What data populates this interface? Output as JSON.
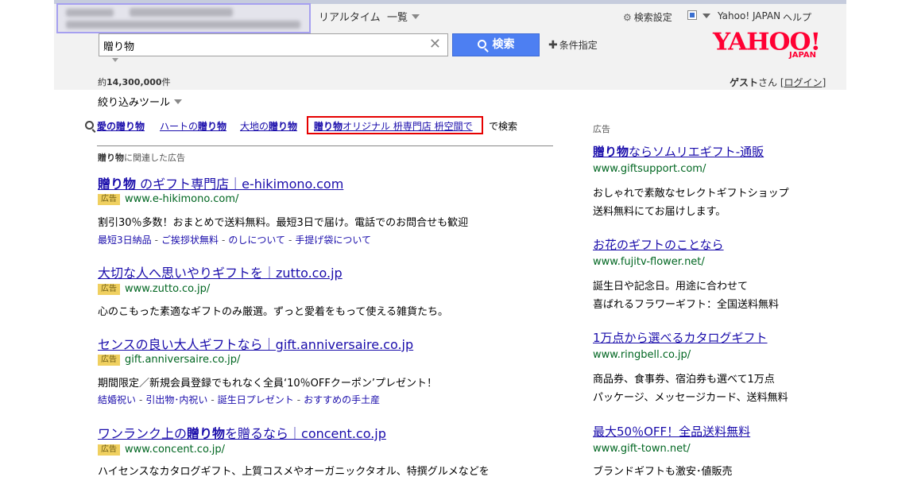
{
  "header": {
    "nav_realtime": "リアルタイム",
    "nav_list": "一覧",
    "settings": "検索設定",
    "yahoo_japan": "Yahoo! JAPAN",
    "help": "ヘルプ",
    "logo_main": "YAHOO!",
    "logo_sub": "JAPAN"
  },
  "search": {
    "query": "贈り物",
    "button": "検索",
    "advanced": "条件指定"
  },
  "results": {
    "count_prefix": "約",
    "count": "14,300,000",
    "count_suffix": "件"
  },
  "user": {
    "name": "ゲスト",
    "honorific": "さん",
    "bracket_open": "[",
    "login": "ログイン",
    "bracket_close": "]"
  },
  "filter": {
    "label": "絞り込みツール"
  },
  "related": {
    "items": [
      {
        "bold": "愛の贈り物",
        "rest": ""
      },
      {
        "bold": "",
        "pre": "ハートの",
        "bold2": "贈り物"
      },
      {
        "bold": "",
        "pre": "大地の",
        "bold2": "贈り物"
      },
      {
        "bold": "贈り物",
        "rest": "オリジナル 枡専門店 枡空間で"
      }
    ],
    "suffix": "で検索"
  },
  "ad_heading": {
    "bold": "贈り物",
    "rest": "に関連した広告"
  },
  "badge_label": "広告",
  "main_ads": [
    {
      "title_bold": "贈り物",
      "title_rest": " のギフト専門店｜e-hikimono.com",
      "url": "www.e-hikimono.com/",
      "desc": "割引30％多数！おまとめで送料無料。最短3日で届け。電話でのお問合せも歓迎",
      "sitelinks": [
        "最短3日納品",
        "ご挨拶状無料",
        "のしについて",
        "手提げ袋について"
      ]
    },
    {
      "title_pre": "大切な人へ思いやりギフトを｜zutto.co.jp",
      "url": "www.zutto.co.jp/",
      "desc": "心のこもった素適なギフトのみ厳選。ずっと愛着をもって使える雑貨たち。"
    },
    {
      "title_pre": "センスの良い大人ギフトなら｜gift.anniversaire.co.jp",
      "url": "gift.anniversaire.co.jp/",
      "desc": "期間限定／新規会員登録でもれなく全員‘10％OFFクーポン’プレゼント！",
      "sitelinks": [
        "結婚祝い",
        "引出物･内祝い",
        "誕生日プレゼント",
        "おすすめの手土産"
      ]
    },
    {
      "title_pre": "ワンランク上の",
      "title_bold": "贈り物",
      "title_rest": "を贈るなら｜concent.co.jp",
      "url": "www.concent.co.jp/",
      "desc": "ハイセンスなカタログギフト、上質コスメやオーガニックタオル、特撰グルメなどを"
    }
  ],
  "side_heading": "広告",
  "side_ads": [
    {
      "title_bold": "贈り物",
      "title_rest": "ならソムリエギフト-通販",
      "url": "www.giftsupport.com/",
      "desc1": "おしゃれで素敵なセレクトギフトショップ",
      "desc2": "送料無料にてお届けします。"
    },
    {
      "title_rest": "お花のギフトのことなら",
      "url": "www.fujitv-flower.net/",
      "desc1": "誕生日や記念日。用途に合わせて",
      "desc2": "喜ばれるフラワーギフト：全国送料無料"
    },
    {
      "title_rest": "1万点から選べるカタログギフト",
      "url": "www.ringbell.co.jp/",
      "desc1": "商品券、食事券、宿泊券も選べて1万点",
      "desc2": "パッケージ、メッセージカード、送料無料"
    },
    {
      "title_rest": "最大50％OFF！全品送料無料",
      "url": "www.gift-town.net/",
      "desc1": "ブランドギフトも激安･値販売"
    }
  ],
  "colors": {
    "link": "#1a0dab",
    "url_green": "#006621",
    "search_button": "#4d7ff2",
    "logo_red": "#ff0033",
    "badge": "#f0d060",
    "highlight_border": "#e60000"
  }
}
